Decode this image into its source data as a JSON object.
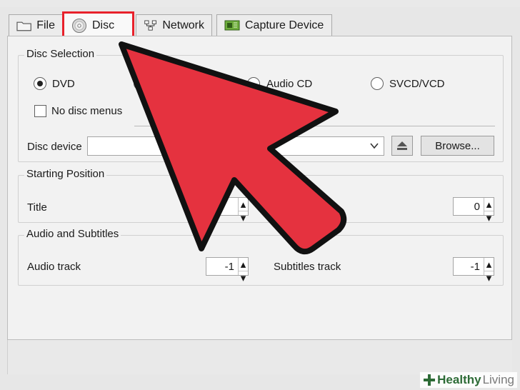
{
  "tabs": [
    {
      "label": "File",
      "icon": "folder-icon"
    },
    {
      "label": "Disc",
      "icon": "disc-icon",
      "active": true
    },
    {
      "label": "Network",
      "icon": "network-icon"
    },
    {
      "label": "Capture Device",
      "icon": "capture-card-icon"
    }
  ],
  "disc_selection": {
    "title": "Disc Selection",
    "options": [
      {
        "label": "DVD",
        "checked": true
      },
      {
        "label": "Audio CD",
        "checked": false
      },
      {
        "label": "SVCD/VCD",
        "checked": false
      }
    ],
    "no_disc_menus": "No disc menus",
    "device_label": "Disc device",
    "device_value": "",
    "browse_label": "Browse..."
  },
  "starting_position": {
    "title": "Starting Position",
    "title_label": "Title",
    "title_value": "",
    "chapter_value": "0"
  },
  "audio_subtitles": {
    "title": "Audio and Subtitles",
    "audio_label": "Audio track",
    "audio_value": "-1",
    "subtitles_label": "Subtitles track",
    "subtitles_value": "-1"
  },
  "watermark": {
    "part1": "Healthy",
    "part2": "Living"
  },
  "colors": {
    "highlight": "#e8212b",
    "arrow": "#e5323f",
    "arrow_outline": "#111111"
  }
}
